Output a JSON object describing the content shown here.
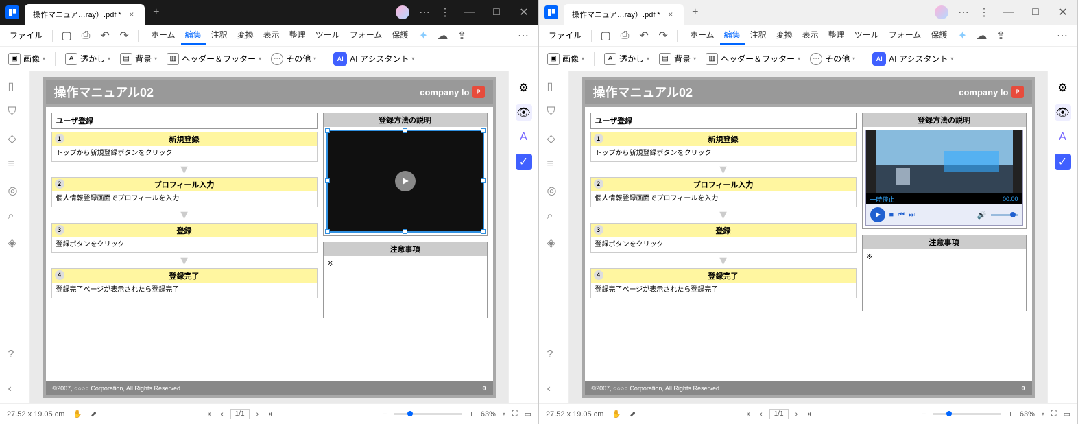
{
  "tab_title": "操作マニュア…ray）.pdf *",
  "menu_file": "ファイル",
  "menu_tabs": [
    "ホーム",
    "編集",
    "注釈",
    "変換",
    "表示",
    "整理",
    "ツール",
    "フォーム",
    "保護"
  ],
  "active_tab": "編集",
  "tools": {
    "image": "画像",
    "watermark": "透かし",
    "background": "背景",
    "headerfooter": "ヘッダー＆フッター",
    "other": "その他",
    "ai": "AI アシスタント"
  },
  "doc": {
    "title": "操作マニュアル02",
    "company": "company lo",
    "section": "ユーザ登録",
    "steps": [
      {
        "n": "1",
        "h": "新規登録",
        "b": "トップから新規登録ボタンをクリック"
      },
      {
        "n": "2",
        "h": "プロフィール入力",
        "b": "個人情報登録画面でプロフィールを入力"
      },
      {
        "n": "3",
        "h": "登録",
        "b": "登録ボタンをクリック"
      },
      {
        "n": "4",
        "h": "登録完了",
        "b": "登録完了ページが表示されたら登録完了"
      }
    ],
    "explain_title": "登録方法の説明",
    "notes_title": "注意事項",
    "notes_body": "※",
    "footer": "©2007, ○○○○ Corporation, All Rights Reserved",
    "footer_badge": "0"
  },
  "player": {
    "status": "一時停止",
    "time": "00:00"
  },
  "status": {
    "dims": "27.52 x 19.05 cm",
    "page_cur": "1",
    "page_total": "/1",
    "zoom": "63%"
  }
}
